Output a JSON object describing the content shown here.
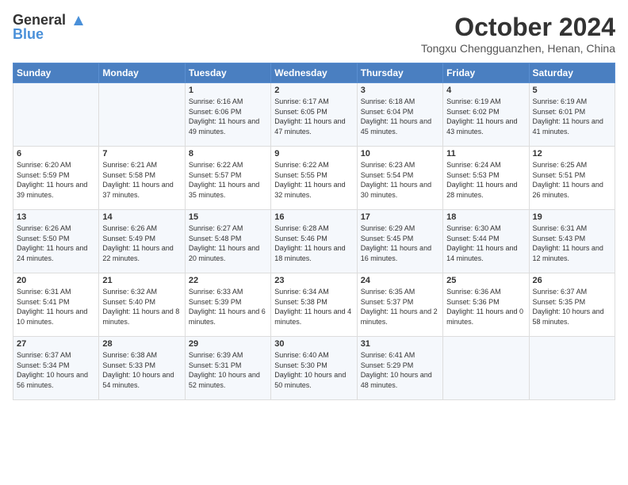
{
  "logo": {
    "line1": "General",
    "line2": "Blue"
  },
  "title": "October 2024",
  "location": "Tongxu Chengguanzhen, Henan, China",
  "headers": [
    "Sunday",
    "Monday",
    "Tuesday",
    "Wednesday",
    "Thursday",
    "Friday",
    "Saturday"
  ],
  "weeks": [
    [
      {
        "day": "",
        "sunrise": "",
        "sunset": "",
        "daylight": ""
      },
      {
        "day": "",
        "sunrise": "",
        "sunset": "",
        "daylight": ""
      },
      {
        "day": "1",
        "sunrise": "Sunrise: 6:16 AM",
        "sunset": "Sunset: 6:06 PM",
        "daylight": "Daylight: 11 hours and 49 minutes."
      },
      {
        "day": "2",
        "sunrise": "Sunrise: 6:17 AM",
        "sunset": "Sunset: 6:05 PM",
        "daylight": "Daylight: 11 hours and 47 minutes."
      },
      {
        "day": "3",
        "sunrise": "Sunrise: 6:18 AM",
        "sunset": "Sunset: 6:04 PM",
        "daylight": "Daylight: 11 hours and 45 minutes."
      },
      {
        "day": "4",
        "sunrise": "Sunrise: 6:19 AM",
        "sunset": "Sunset: 6:02 PM",
        "daylight": "Daylight: 11 hours and 43 minutes."
      },
      {
        "day": "5",
        "sunrise": "Sunrise: 6:19 AM",
        "sunset": "Sunset: 6:01 PM",
        "daylight": "Daylight: 11 hours and 41 minutes."
      }
    ],
    [
      {
        "day": "6",
        "sunrise": "Sunrise: 6:20 AM",
        "sunset": "Sunset: 5:59 PM",
        "daylight": "Daylight: 11 hours and 39 minutes."
      },
      {
        "day": "7",
        "sunrise": "Sunrise: 6:21 AM",
        "sunset": "Sunset: 5:58 PM",
        "daylight": "Daylight: 11 hours and 37 minutes."
      },
      {
        "day": "8",
        "sunrise": "Sunrise: 6:22 AM",
        "sunset": "Sunset: 5:57 PM",
        "daylight": "Daylight: 11 hours and 35 minutes."
      },
      {
        "day": "9",
        "sunrise": "Sunrise: 6:22 AM",
        "sunset": "Sunset: 5:55 PM",
        "daylight": "Daylight: 11 hours and 32 minutes."
      },
      {
        "day": "10",
        "sunrise": "Sunrise: 6:23 AM",
        "sunset": "Sunset: 5:54 PM",
        "daylight": "Daylight: 11 hours and 30 minutes."
      },
      {
        "day": "11",
        "sunrise": "Sunrise: 6:24 AM",
        "sunset": "Sunset: 5:53 PM",
        "daylight": "Daylight: 11 hours and 28 minutes."
      },
      {
        "day": "12",
        "sunrise": "Sunrise: 6:25 AM",
        "sunset": "Sunset: 5:51 PM",
        "daylight": "Daylight: 11 hours and 26 minutes."
      }
    ],
    [
      {
        "day": "13",
        "sunrise": "Sunrise: 6:26 AM",
        "sunset": "Sunset: 5:50 PM",
        "daylight": "Daylight: 11 hours and 24 minutes."
      },
      {
        "day": "14",
        "sunrise": "Sunrise: 6:26 AM",
        "sunset": "Sunset: 5:49 PM",
        "daylight": "Daylight: 11 hours and 22 minutes."
      },
      {
        "day": "15",
        "sunrise": "Sunrise: 6:27 AM",
        "sunset": "Sunset: 5:48 PM",
        "daylight": "Daylight: 11 hours and 20 minutes."
      },
      {
        "day": "16",
        "sunrise": "Sunrise: 6:28 AM",
        "sunset": "Sunset: 5:46 PM",
        "daylight": "Daylight: 11 hours and 18 minutes."
      },
      {
        "day": "17",
        "sunrise": "Sunrise: 6:29 AM",
        "sunset": "Sunset: 5:45 PM",
        "daylight": "Daylight: 11 hours and 16 minutes."
      },
      {
        "day": "18",
        "sunrise": "Sunrise: 6:30 AM",
        "sunset": "Sunset: 5:44 PM",
        "daylight": "Daylight: 11 hours and 14 minutes."
      },
      {
        "day": "19",
        "sunrise": "Sunrise: 6:31 AM",
        "sunset": "Sunset: 5:43 PM",
        "daylight": "Daylight: 11 hours and 12 minutes."
      }
    ],
    [
      {
        "day": "20",
        "sunrise": "Sunrise: 6:31 AM",
        "sunset": "Sunset: 5:41 PM",
        "daylight": "Daylight: 11 hours and 10 minutes."
      },
      {
        "day": "21",
        "sunrise": "Sunrise: 6:32 AM",
        "sunset": "Sunset: 5:40 PM",
        "daylight": "Daylight: 11 hours and 8 minutes."
      },
      {
        "day": "22",
        "sunrise": "Sunrise: 6:33 AM",
        "sunset": "Sunset: 5:39 PM",
        "daylight": "Daylight: 11 hours and 6 minutes."
      },
      {
        "day": "23",
        "sunrise": "Sunrise: 6:34 AM",
        "sunset": "Sunset: 5:38 PM",
        "daylight": "Daylight: 11 hours and 4 minutes."
      },
      {
        "day": "24",
        "sunrise": "Sunrise: 6:35 AM",
        "sunset": "Sunset: 5:37 PM",
        "daylight": "Daylight: 11 hours and 2 minutes."
      },
      {
        "day": "25",
        "sunrise": "Sunrise: 6:36 AM",
        "sunset": "Sunset: 5:36 PM",
        "daylight": "Daylight: 11 hours and 0 minutes."
      },
      {
        "day": "26",
        "sunrise": "Sunrise: 6:37 AM",
        "sunset": "Sunset: 5:35 PM",
        "daylight": "Daylight: 10 hours and 58 minutes."
      }
    ],
    [
      {
        "day": "27",
        "sunrise": "Sunrise: 6:37 AM",
        "sunset": "Sunset: 5:34 PM",
        "daylight": "Daylight: 10 hours and 56 minutes."
      },
      {
        "day": "28",
        "sunrise": "Sunrise: 6:38 AM",
        "sunset": "Sunset: 5:33 PM",
        "daylight": "Daylight: 10 hours and 54 minutes."
      },
      {
        "day": "29",
        "sunrise": "Sunrise: 6:39 AM",
        "sunset": "Sunset: 5:31 PM",
        "daylight": "Daylight: 10 hours and 52 minutes."
      },
      {
        "day": "30",
        "sunrise": "Sunrise: 6:40 AM",
        "sunset": "Sunset: 5:30 PM",
        "daylight": "Daylight: 10 hours and 50 minutes."
      },
      {
        "day": "31",
        "sunrise": "Sunrise: 6:41 AM",
        "sunset": "Sunset: 5:29 PM",
        "daylight": "Daylight: 10 hours and 48 minutes."
      },
      {
        "day": "",
        "sunrise": "",
        "sunset": "",
        "daylight": ""
      },
      {
        "day": "",
        "sunrise": "",
        "sunset": "",
        "daylight": ""
      }
    ]
  ]
}
